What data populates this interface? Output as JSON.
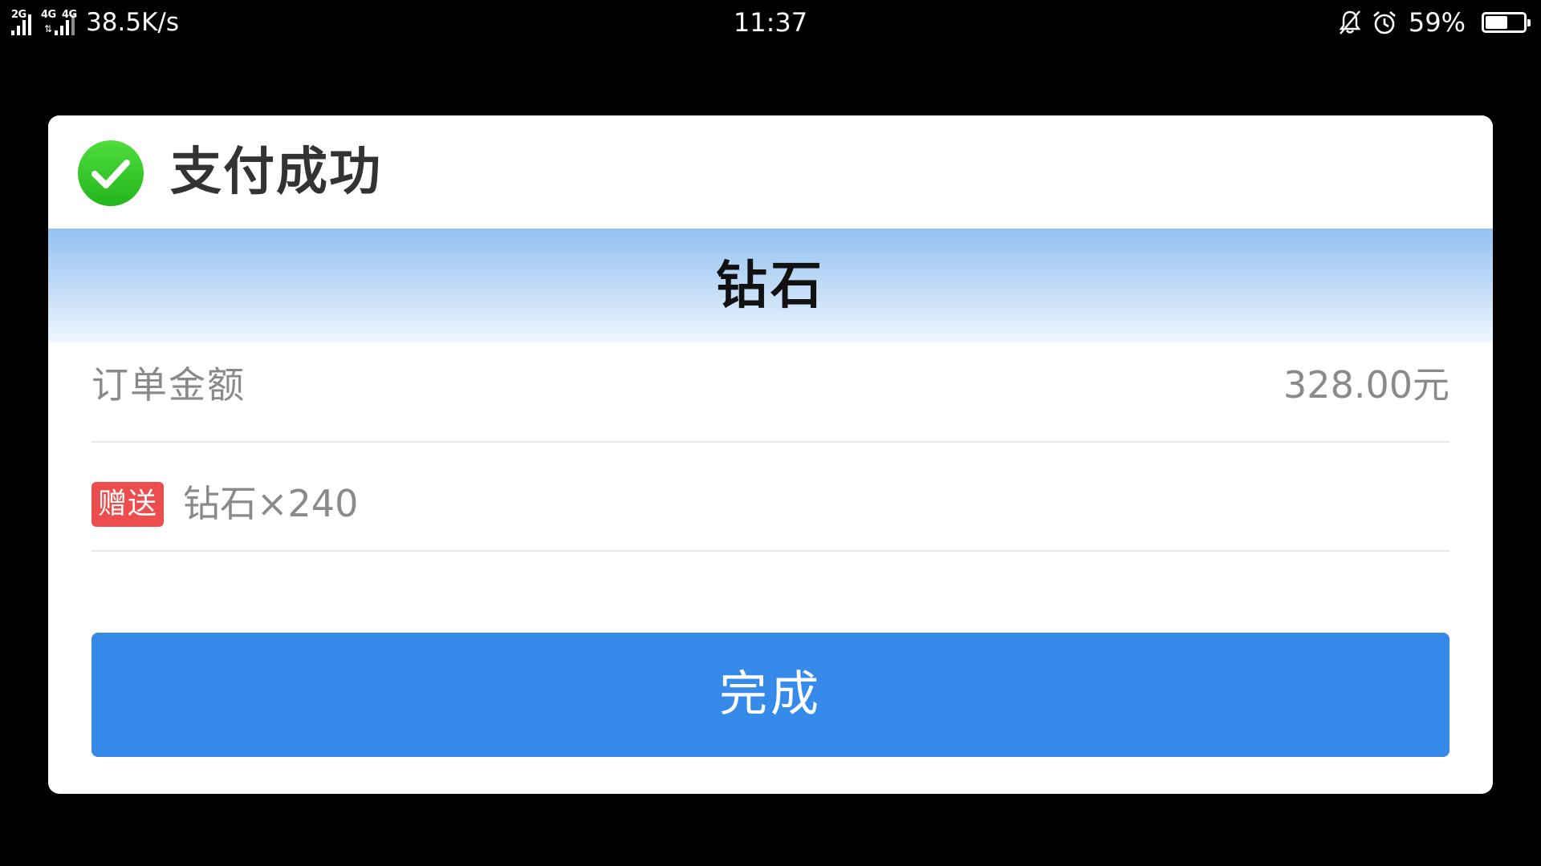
{
  "status_bar": {
    "sim1_network": "2G",
    "sim2_network": "4G",
    "sim2_data_network": "4G",
    "data_speed": "38.5K/s",
    "time": "11:37",
    "battery_percent_text": "59%",
    "battery_level": 0.59,
    "icons": [
      "signal-icon",
      "data-activity-icon",
      "mute-bell-icon",
      "alarm-icon",
      "battery-icon"
    ]
  },
  "dialog": {
    "title": "支付成功",
    "product_name": "钻石",
    "order_amount_label": "订单金额",
    "order_amount_value": "328.00元",
    "gift_badge": "赠送",
    "gift_text": "钻石×240",
    "done_label": "完成"
  },
  "colors": {
    "success_green": "#3fd12f",
    "badge_red": "#ee4d4d",
    "button_blue": "#358aea",
    "band_blue": "#94c1f1"
  }
}
